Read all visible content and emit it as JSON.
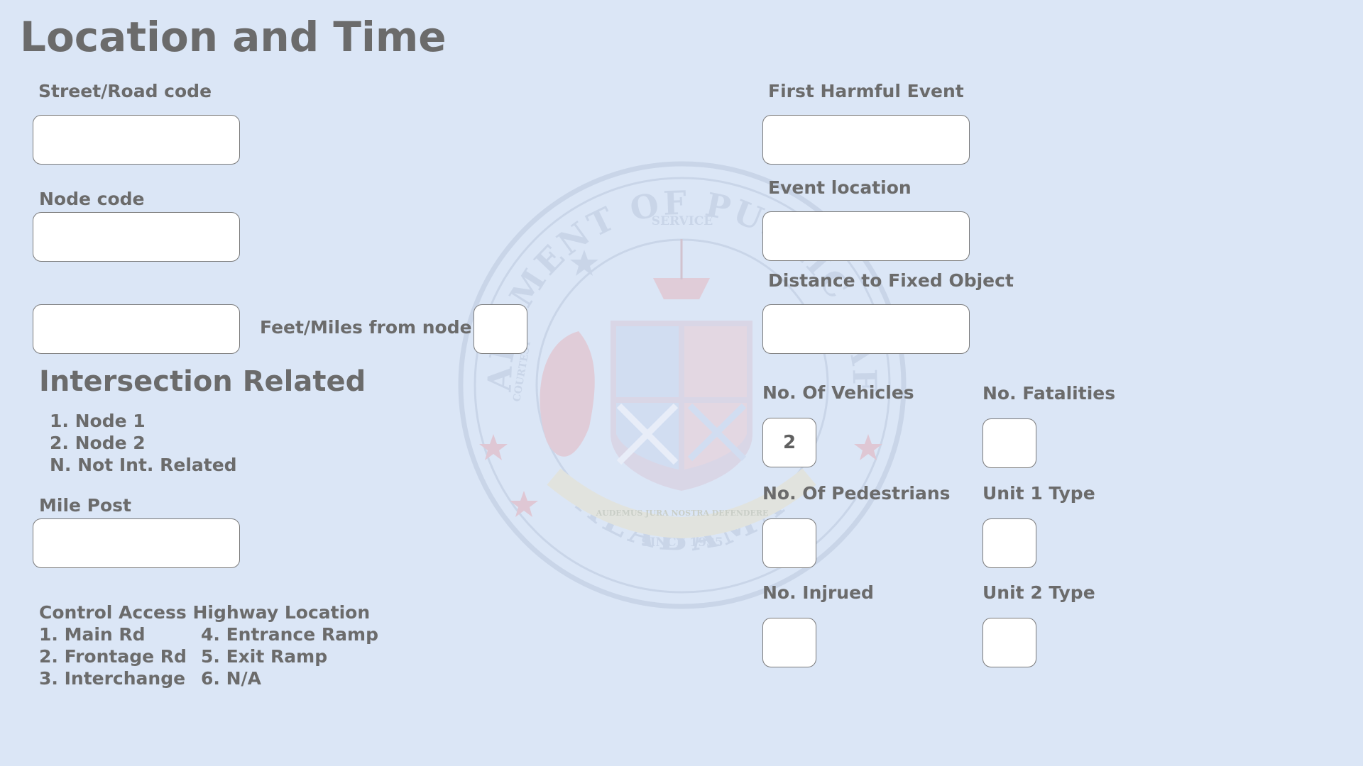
{
  "header": {
    "title": "Location and Time"
  },
  "left": {
    "street_road_code": {
      "label": "Street/Road code",
      "value": ""
    },
    "node_code": {
      "label": "Node code",
      "value": ""
    },
    "distance_from_node": {
      "value": "",
      "unit_label": "Feet/Miles from node",
      "unit_value": ""
    },
    "intersection": {
      "title": "Intersection Related",
      "options": [
        "1. Node 1",
        "2. Node 2",
        "N. Not Int. Related"
      ]
    },
    "mile_post": {
      "label": "Mile Post",
      "value": ""
    },
    "control_access": {
      "title": "Control Access Highway Location",
      "options_col1": [
        "1. Main Rd",
        "2. Frontage Rd",
        "3. Interchange"
      ],
      "options_col2": [
        "4. Entrance Ramp",
        "5. Exit Ramp",
        "6. N/A"
      ]
    }
  },
  "right": {
    "first_harmful_event": {
      "label": "First Harmful Event",
      "value": ""
    },
    "event_location": {
      "label": "Event location",
      "value": ""
    },
    "distance_fixed_object": {
      "label": "Distance to Fixed Object",
      "value": ""
    },
    "vehicles": {
      "label": "No. Of Vehicles",
      "value": "2"
    },
    "fatalities": {
      "label": "No. Fatalities",
      "value": ""
    },
    "pedestrians": {
      "label": "No. Of Pedestrians",
      "value": ""
    },
    "unit1_type": {
      "label": "Unit 1 Type",
      "value": ""
    },
    "injured": {
      "label": "No. Injrued",
      "value": ""
    },
    "unit2_type": {
      "label": "Unit 2 Type",
      "value": ""
    }
  },
  "watermark": {
    "icon": "state-seal-watermark",
    "text_top": "DEPARTMENT OF PUBLIC SAFETY",
    "text_bottom": "ALABAMA",
    "service": "SERVICE",
    "since": "SINCE 1935",
    "courtesy": "COURTESY",
    "motto": "AUDEMUS JURA NOSTRA DEFENDERE"
  },
  "colors": {
    "background": "#dbe6f6",
    "text": "#6b6b6b",
    "field_border": "#7a7a7a"
  }
}
